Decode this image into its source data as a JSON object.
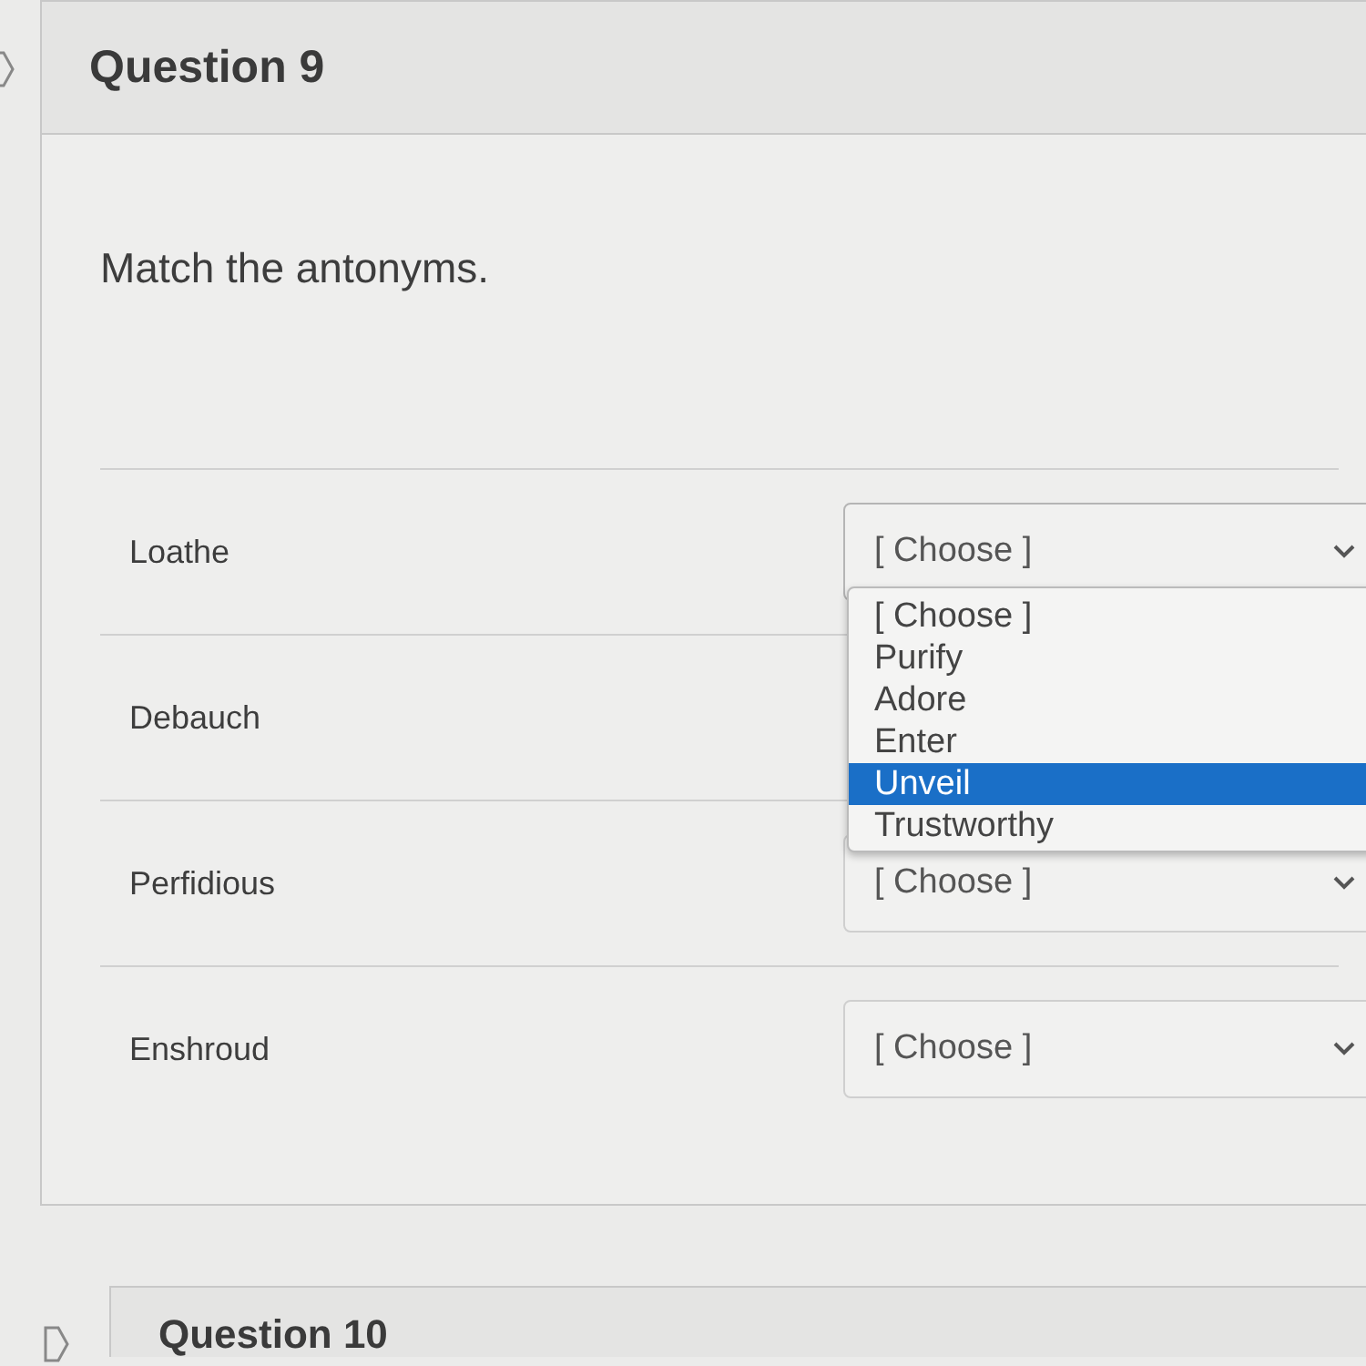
{
  "questions": [
    {
      "title": "Question 9",
      "prompt": "Match the antonyms.",
      "pairs": [
        {
          "term": "Loathe",
          "answer": "[ Choose ]",
          "open": true,
          "options": [
            {
              "label": "[ Choose ]",
              "selected": false
            },
            {
              "label": "Purify",
              "selected": false
            },
            {
              "label": "Adore",
              "selected": false
            },
            {
              "label": "Enter",
              "selected": false
            },
            {
              "label": "Unveil",
              "selected": true
            },
            {
              "label": "Trustworthy",
              "selected": false
            }
          ]
        },
        {
          "term": "Debauch"
        },
        {
          "term": "Perfidious",
          "answer": "[ Choose ]",
          "open": false
        },
        {
          "term": "Enshroud",
          "answer": "[ Choose ]",
          "open": false
        }
      ]
    },
    {
      "title": "Question 10"
    }
  ]
}
